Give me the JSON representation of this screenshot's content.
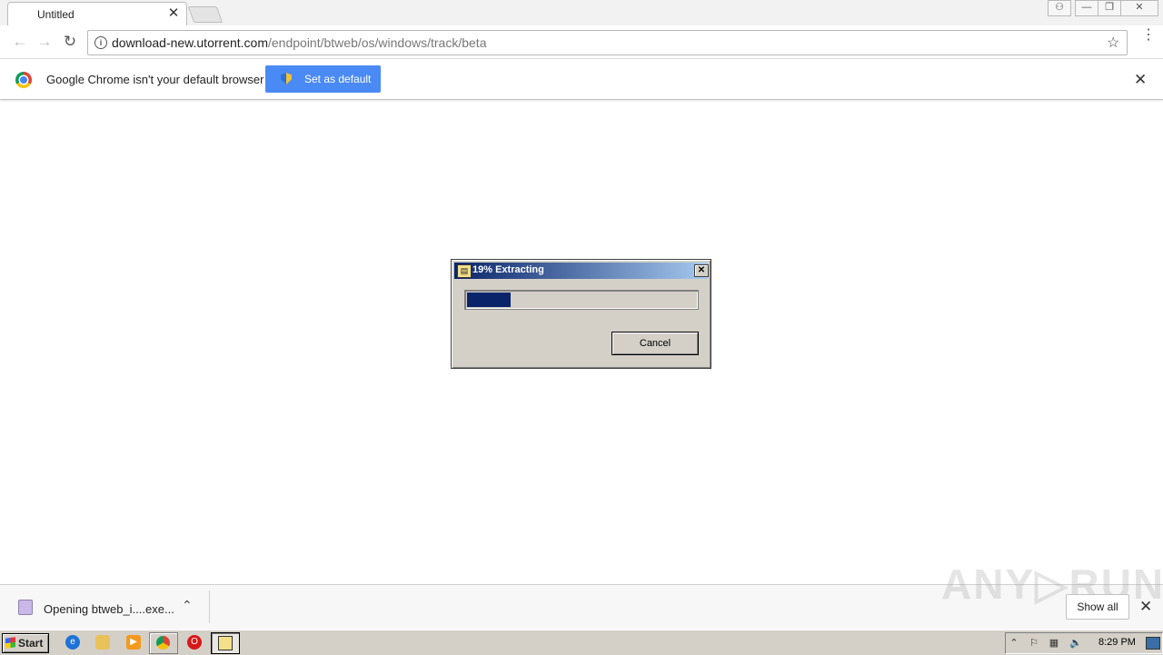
{
  "browser": {
    "tab": {
      "title": "Untitled",
      "close_glyph": "✕"
    },
    "window_controls": {
      "profile_icon": "person-icon",
      "minimize_glyph": "—",
      "restore_glyph": "❐",
      "close_glyph": "✕"
    },
    "toolbar": {
      "back_glyph": "←",
      "forward_glyph": "→",
      "reload_glyph": "↻",
      "info_glyph": "i",
      "url_host": "download-new.utorrent.com",
      "url_path": "/endpoint/btweb/os/windows/track/beta",
      "star_glyph": "☆",
      "menu_glyph": "⋮"
    },
    "infobar": {
      "message": "Google Chrome isn't your default browser",
      "button_label": "Set as default",
      "close_glyph": "✕"
    }
  },
  "dialog": {
    "title": "19% Extracting",
    "progress_percent": 19,
    "cancel_label": "Cancel",
    "close_glyph": "✕",
    "icon_glyph": "▤"
  },
  "download_shelf": {
    "item_label": "Opening btweb_i....exe...",
    "chevron_glyph": "⌃",
    "show_all_label": "Show all",
    "close_glyph": "✕",
    "watermark": "ANY▷RUN"
  },
  "taskbar": {
    "start_label": "Start",
    "tray": {
      "clock": "8:29 PM",
      "arrow_glyph": "⌃",
      "flag_glyph": "⚐",
      "network_glyph": "▦",
      "volume_glyph": "🔈"
    }
  },
  "colors": {
    "accent_blue": "#4a8af4",
    "titlebar_start": "#0a246a",
    "titlebar_end": "#a6caf0",
    "progress": "#0a246a"
  }
}
